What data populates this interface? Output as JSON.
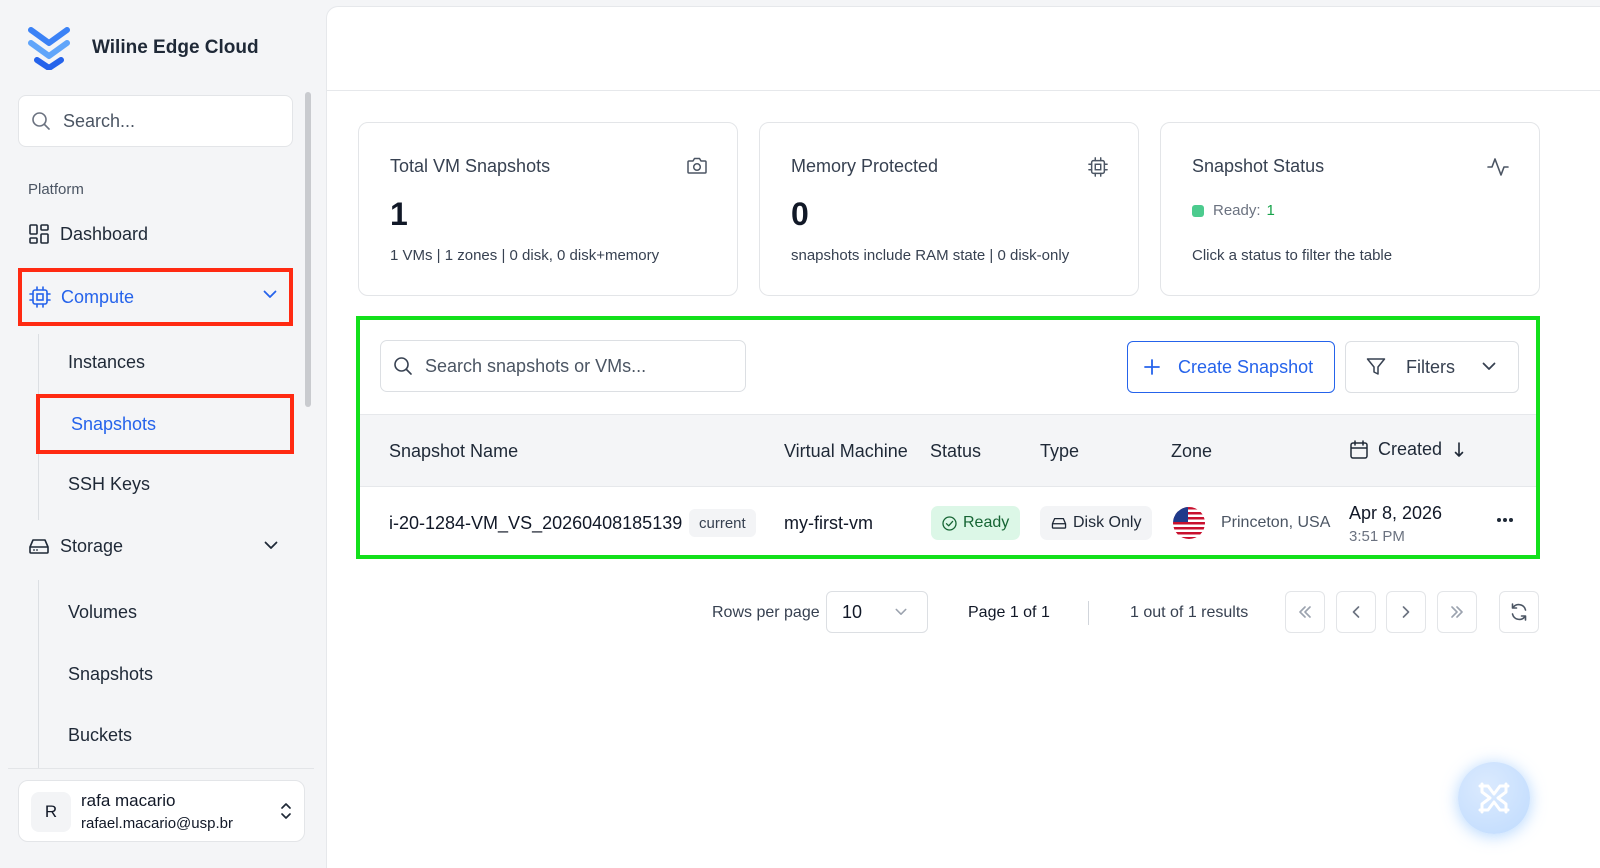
{
  "brand": {
    "name": "Wiline Edge Cloud",
    "logo": "wiline-logo-icon"
  },
  "sidebar": {
    "search_placeholder": "Search...",
    "section_label": "Platform",
    "dashboard_label": "Dashboard",
    "compute": {
      "label": "Compute",
      "items": [
        {
          "label": "Instances"
        },
        {
          "label": "Snapshots",
          "active": true
        },
        {
          "label": "SSH Keys"
        }
      ]
    },
    "storage": {
      "label": "Storage",
      "items": [
        {
          "label": "Volumes"
        },
        {
          "label": "Snapshots"
        },
        {
          "label": "Buckets"
        }
      ]
    },
    "user": {
      "initial": "R",
      "name": "rafa macario",
      "email": "rafael.macario@usp.br"
    }
  },
  "stats": [
    {
      "title": "Total VM Snapshots",
      "icon": "camera-icon",
      "value": "1",
      "sub": "1 VMs | 1 zones | 0 disk, 0 disk+memory"
    },
    {
      "title": "Memory Protected",
      "icon": "cpu-chip-icon",
      "value": "0",
      "sub": "snapshots include RAM state | 0 disk-only"
    },
    {
      "title": "Snapshot Status",
      "icon": "activity-icon",
      "status_label": "Ready:",
      "status_count": "1",
      "sub": "Click a status to filter the table"
    }
  ],
  "table": {
    "search_placeholder": "Search snapshots or VMs...",
    "create_label": "Create Snapshot",
    "filters_label": "Filters",
    "columns": [
      "Snapshot Name",
      "Virtual Machine",
      "Status",
      "Type",
      "Zone",
      "Created"
    ],
    "rows": [
      {
        "name": "i-20-1284-VM_VS_20260408185139",
        "badge": "current",
        "vm": "my-first-vm",
        "status": "Ready",
        "type": "Disk Only",
        "zone": "Princeton, USA",
        "created_date": "Apr 8, 2026",
        "created_time": "3:51 PM"
      }
    ]
  },
  "pagination": {
    "rows_per_page_label": "Rows per page",
    "rows_per_page": "10",
    "page_info": "Page 1 of 1",
    "results": "1 out of 1 results"
  },
  "colors": {
    "accent": "#2563eb",
    "highlight_red": "#ff2a12",
    "highlight_green": "#12e01b",
    "ready_bg": "#dcf7e7"
  }
}
